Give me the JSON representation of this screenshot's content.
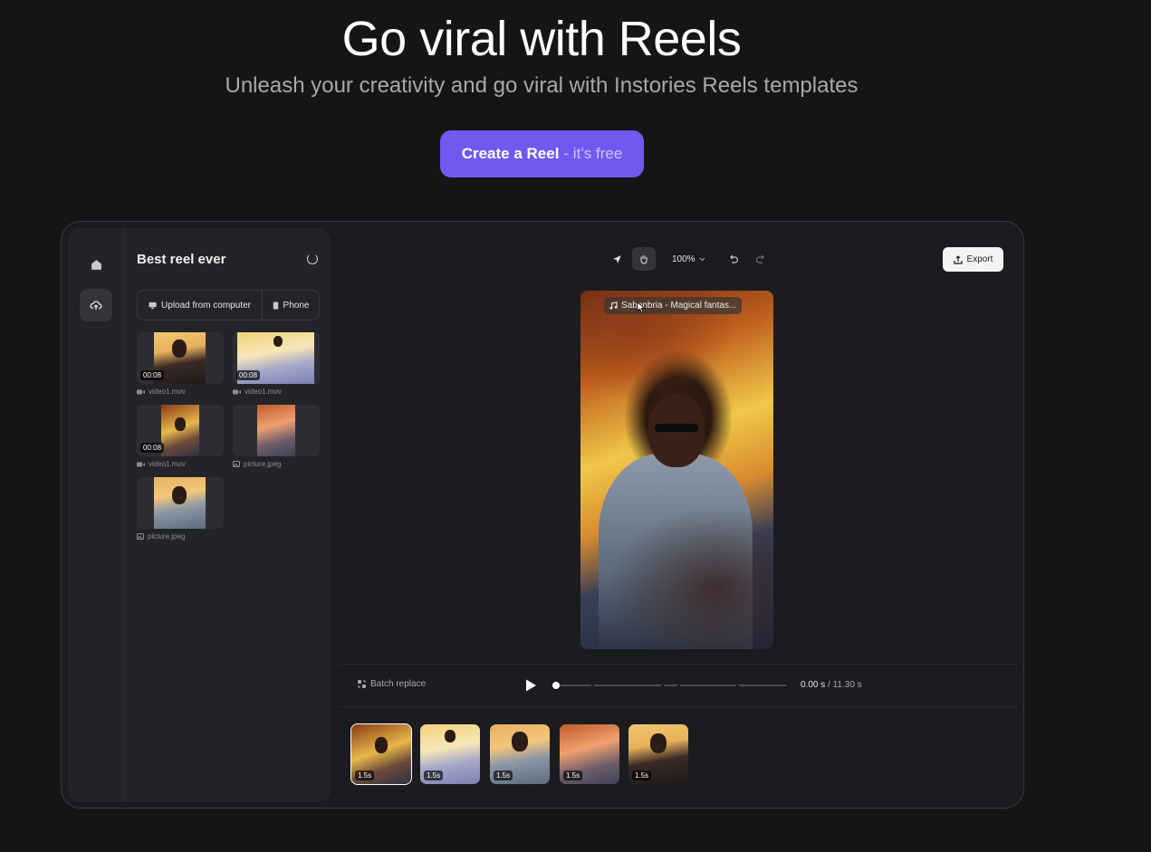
{
  "hero": {
    "title": "Go viral with Reels",
    "subtitle": "Unleash your creativity and go viral with Instories Reels templates",
    "cta_main": "Create a Reel",
    "cta_sub": "- it’s free"
  },
  "editor": {
    "project_title": "Best reel ever",
    "upload_from_computer": "Upload from computer",
    "upload_phone": "Phone",
    "media": [
      {
        "name": "video1.mov",
        "duration": "00:08",
        "type": "video"
      },
      {
        "name": "video1.mov",
        "duration": "00:08",
        "type": "video"
      },
      {
        "name": "video1.mov",
        "duration": "00:08",
        "type": "video"
      },
      {
        "name": "picture.jpeg",
        "duration": "",
        "type": "image"
      },
      {
        "name": "picture.jpeg",
        "duration": "",
        "type": "image"
      }
    ],
    "zoom": "100%",
    "export_label": "Export",
    "music_track": "Sabonbria - Magical fantas...",
    "batch_replace": "Batch replace",
    "time_current": "0.00 s",
    "time_sep": "/",
    "time_total": "11.30 s",
    "clips": [
      {
        "duration": "1.5s",
        "selected": true
      },
      {
        "duration": "1.5s",
        "selected": false
      },
      {
        "duration": "1.5s",
        "selected": false
      },
      {
        "duration": "1.5s",
        "selected": false
      },
      {
        "duration": "1.5s",
        "selected": false
      }
    ]
  },
  "colors": {
    "background": "#151517",
    "accent": "#7059f0",
    "frame_bg": "#1b1c1f",
    "panel_bg": "#232427"
  }
}
